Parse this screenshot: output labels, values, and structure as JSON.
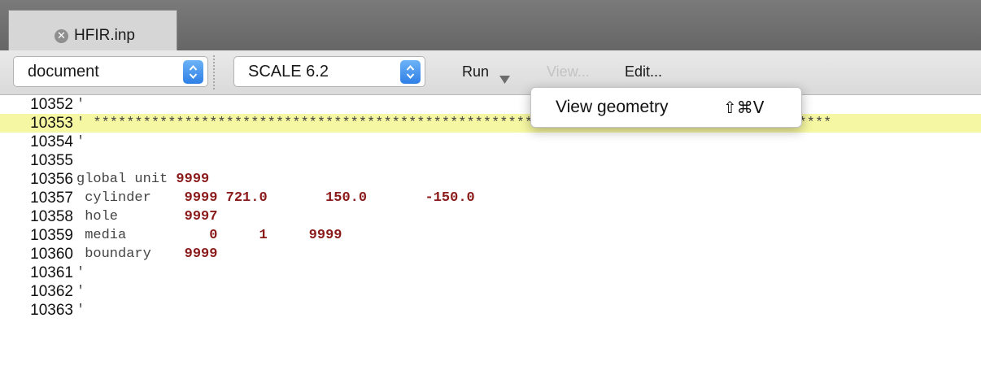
{
  "tab": {
    "title": "HFIR.inp",
    "close_icon": "close-circle-icon"
  },
  "toolbar": {
    "document_select": "document",
    "scale_select": "SCALE 6.2",
    "run_label": "Run",
    "view_label": "View...",
    "edit_label": "Edit..."
  },
  "menu": {
    "item_label": "View geometry",
    "item_shortcut": "⇧⌘V"
  },
  "editor": {
    "lines": [
      {
        "num": "10352",
        "text": "'"
      },
      {
        "num": "10353",
        "text": "' *****************************************************************************************"
      },
      {
        "num": "10354",
        "text": "'"
      },
      {
        "num": "10355",
        "text": ""
      },
      {
        "num": "10356",
        "text": "global unit 9999"
      },
      {
        "num": "10357",
        "text": " cylinder    9999 721.0       150.0       -150.0"
      },
      {
        "num": "10358",
        "text": " hole        9997"
      },
      {
        "num": "10359",
        "text": " media          0     1     9999"
      },
      {
        "num": "10360",
        "text": " boundary    9999"
      },
      {
        "num": "10361",
        "text": "'"
      },
      {
        "num": "10362",
        "text": "'"
      },
      {
        "num": "10363",
        "text": "'"
      }
    ],
    "highlighted_line": "10353"
  },
  "colors": {
    "highlight": "#f6f7a2",
    "comment": "#2e8b2e",
    "number": "#8b1a1a",
    "stepper_blue": "#2f7fe6",
    "toolbar_bg": "#e2e2e2",
    "tabbar_bg": "#707070"
  }
}
